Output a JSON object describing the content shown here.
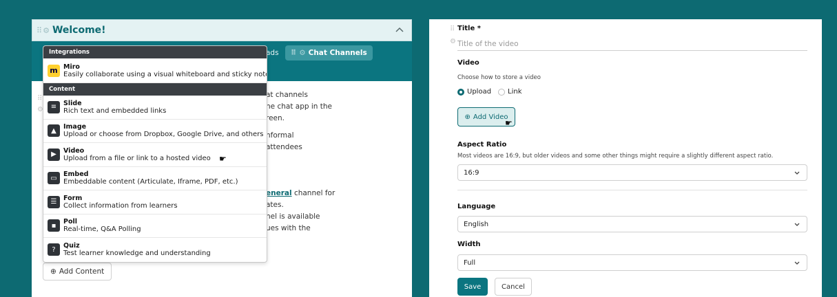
{
  "left": {
    "title": "Welcome!",
    "tabs": {
      "partial": "ads",
      "chat_channels": "Chat Channels"
    },
    "body_lines": [
      "at channels",
      "he chat app in the",
      "reen.",
      "nformal",
      "attendees",
      "channel for",
      "ates.",
      "nel is available",
      "ues with the"
    ],
    "general_link": "eneral",
    "add_content": "Add Content"
  },
  "dropdown": {
    "sections": [
      {
        "label": "Integrations",
        "items": [
          {
            "name": "Miro",
            "desc": "Easily collaborate using a visual whiteboard and sticky notes",
            "icon": "miro-icon"
          }
        ]
      },
      {
        "label": "Content",
        "items": [
          {
            "name": "Slide",
            "desc": "Rich text and embedded links",
            "icon": "slide-icon"
          },
          {
            "name": "Image",
            "desc": "Upload or choose from Dropbox, Google Drive, and others",
            "icon": "image-icon"
          },
          {
            "name": "Video",
            "desc": "Upload from a file or link to a hosted video",
            "icon": "video-icon"
          },
          {
            "name": "Embed",
            "desc": "Embeddable content (Articulate, Iframe, PDF, etc.)",
            "icon": "embed-icon"
          },
          {
            "name": "Form",
            "desc": "Collect information from learners",
            "icon": "form-icon"
          },
          {
            "name": "Poll",
            "desc": "Real-time, Q&A Polling",
            "icon": "poll-icon"
          },
          {
            "name": "Quiz",
            "desc": "Test learner knowledge and understanding",
            "icon": "quiz-icon"
          }
        ]
      }
    ]
  },
  "form": {
    "title_label": "Title *",
    "title_placeholder": "Title of the video",
    "video_label": "Video",
    "video_help": "Choose how to store a video",
    "upload_option": "Upload",
    "link_option": "Link",
    "add_video": "Add Video",
    "aspect_label": "Aspect Ratio",
    "aspect_help": "Most videos are 16:9, but older videos and some other things might require a slightly different aspect ratio.",
    "aspect_value": "16:9",
    "language_label": "Language",
    "language_value": "English",
    "width_label": "Width",
    "width_value": "Full",
    "save": "Save",
    "cancel": "Cancel"
  },
  "colors": {
    "background": "#0d6a72",
    "accent": "#0b7580",
    "miro_yellow": "#ffd02f"
  }
}
